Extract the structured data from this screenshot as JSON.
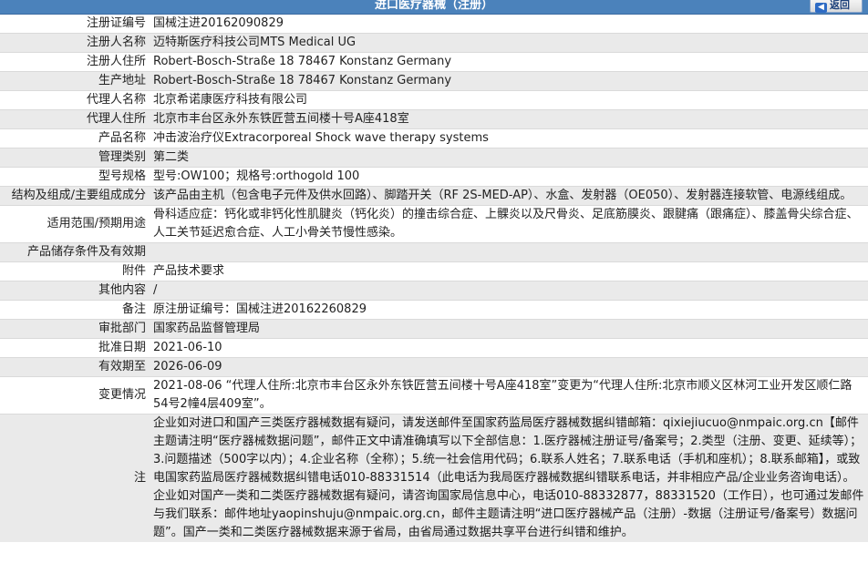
{
  "header": {
    "title": "进口医疗器械（注册）",
    "back_label": "返回"
  },
  "rows": [
    {
      "label": "注册证编号",
      "value": "国械注进20162090829"
    },
    {
      "label": "注册人名称",
      "value": "迈特斯医疗科技公司MTS Medical UG"
    },
    {
      "label": "注册人住所",
      "value": "Robert-Bosch-Straße 18 78467 Konstanz Germany"
    },
    {
      "label": "生产地址",
      "value": "Robert-Bosch-Straße 18 78467 Konstanz Germany"
    },
    {
      "label": "代理人名称",
      "value": "北京希诺康医疗科技有限公司"
    },
    {
      "label": "代理人住所",
      "value": "北京市丰台区永外东铁匠营五间楼十号A座418室"
    },
    {
      "label": "产品名称",
      "value": "冲击波治疗仪Extracorporeal Shock wave therapy systems"
    },
    {
      "label": "管理类别",
      "value": "第二类"
    },
    {
      "label": "型号规格",
      "value": "型号:OW100；规格号:orthogold 100"
    },
    {
      "label": "结构及组成/主要组成成分",
      "value": "该产品由主机（包含电子元件及供水回路）、脚踏开关（RF 2S-MED-AP）、水盒、发射器（OE050）、发射器连接软管、电源线组成。"
    },
    {
      "label": "适用范围/预期用途",
      "value": "骨科适应症：钙化或非钙化性肌腱炎（钙化炎）的撞击综合症、上髁炎以及尺骨炎、足底筋膜炎、跟腱痛（跟痛症）、膝盖骨尖综合症、人工关节延迟愈合症、人工小骨关节慢性感染。"
    },
    {
      "label": "产品储存条件及有效期",
      "value": ""
    },
    {
      "label": "附件",
      "value": "产品技术要求"
    },
    {
      "label": "其他内容",
      "value": "/"
    },
    {
      "label": "备注",
      "value": "原注册证编号：国械注进20162260829"
    },
    {
      "label": "审批部门",
      "value": "国家药品监督管理局"
    },
    {
      "label": "批准日期",
      "value": "2021-06-10"
    },
    {
      "label": "有效期至",
      "value": "2026-06-09"
    },
    {
      "label": "变更情况",
      "value": "2021-08-06 “代理人住所:北京市丰台区永外东铁匠营五间楼十号A座418室”变更为“代理人住所:北京市顺义区林河工业开发区顺仁路54号2幢4层409室”。"
    }
  ],
  "note": {
    "label": "注",
    "text": "企业如对进口和国产三类医疗器械数据有疑问，请发送邮件至国家药监局医疗器械数据纠错邮箱：qixiejiucuo@nmpaic.org.cn【邮件主题请注明“医疗器械数据问题”，邮件正文中请准确填写以下全部信息：1.医疗器械注册证号/备案号；2.类型（注册、变更、延续等）；3.问题描述（500字以内）；4.企业名称（全称）；5.统一社会信用代码；6.联系人姓名；7.联系电话（手机和座机）；8.联系邮箱】，或致电国家药监局医疗器械数据纠错电话010-88331514（此电话为我局医疗器械数据纠错联系电话，并非相应产品/企业业务咨询电话）。企业如对国产一类和二类医疗器械数据有疑问，请咨询国家局信息中心，电话010-88332877，88331520（工作日），也可通过发邮件与我们联系：邮件地址yaopinshuju@nmpaic.org.cn，邮件主题请注明“进口医疗器械产品（注册）-数据（注册证号/备案号）数据问题”。国产一类和二类医疗器械数据来源于省局，由省局通过数据共享平台进行纠错和维护。"
  }
}
